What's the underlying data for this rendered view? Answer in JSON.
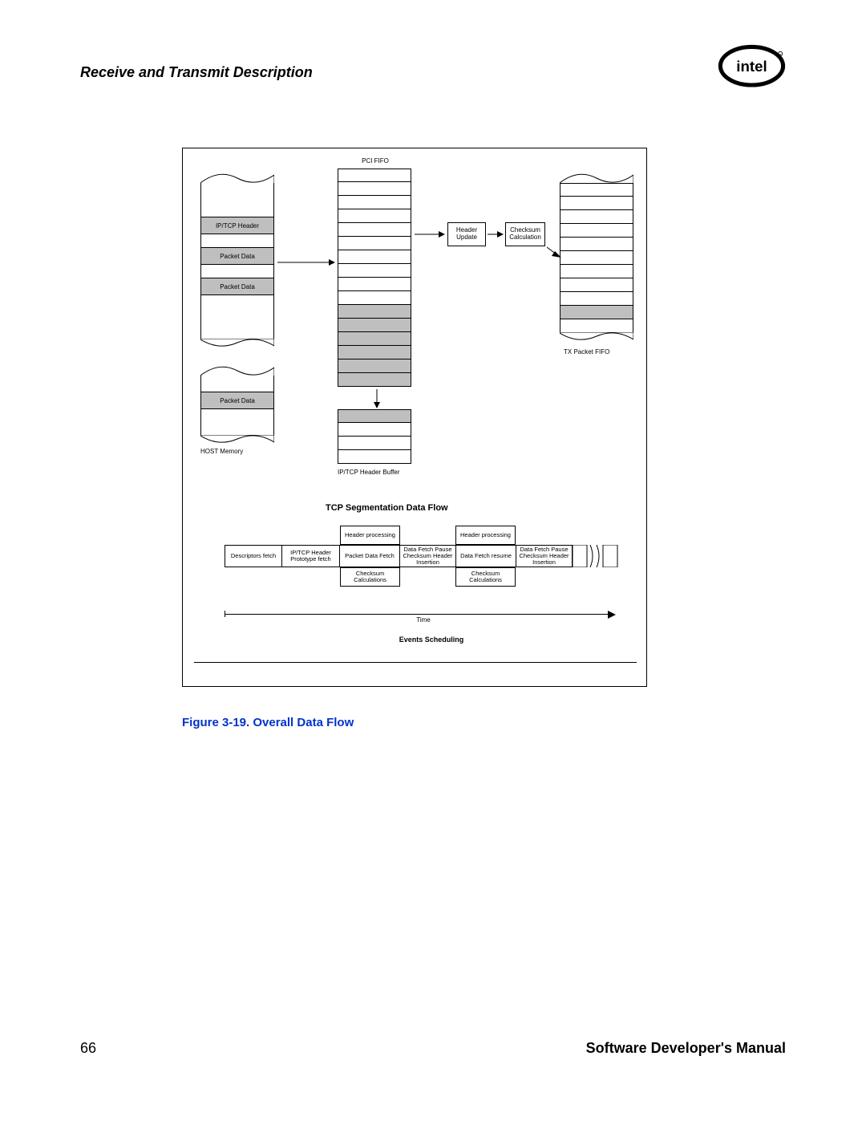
{
  "header": {
    "title": "Receive and Transmit Description"
  },
  "logo": {
    "name": "intel-logo"
  },
  "figure": {
    "caption": "Figure 3-19. Overall Data Flow",
    "top_flow_title": "TCP Segmentation Data Flow",
    "events_title": "Events Scheduling",
    "time_label": "Time",
    "labels": {
      "pci_fifo": "PCI FIFO",
      "ip_tcp_header": "IP/TCP Header",
      "packet_data": "Packet Data",
      "host_memory": "HOST Memory",
      "ip_tcp_header_buffer": "IP/TCP Header Buffer",
      "tx_packet_fifo": "TX Packet FIFO",
      "header_update": "Header Update",
      "checksum_calc": "Checksum Calculation"
    },
    "timeline": {
      "top_row": [
        "Header processing",
        "Header processing"
      ],
      "mid_row": [
        "Descriptors fetch",
        "IP/TCP Header Prototype fetch",
        "Packet Data Fetch",
        "Data Fetch Pause Checksum Header Insertion",
        "Data Fetch resume",
        "Data Fetch Pause Checksum Header Insertion"
      ],
      "bot_row": [
        "Checksum Calculations",
        "Checksum Calculations"
      ]
    }
  },
  "footer": {
    "page": "66",
    "title": "Software Developer's Manual"
  }
}
